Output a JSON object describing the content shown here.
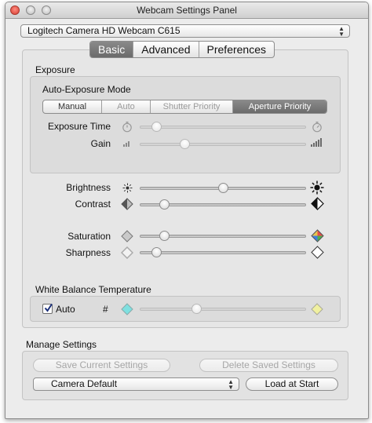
{
  "window": {
    "title": "Webcam Settings Panel"
  },
  "device": {
    "selected": "Logitech Camera HD Webcam C615"
  },
  "tabs": [
    {
      "label": "Basic",
      "selected": true
    },
    {
      "label": "Advanced",
      "selected": false
    },
    {
      "label": "Preferences",
      "selected": false
    }
  ],
  "exposure": {
    "group_label": "Exposure",
    "mode_label": "Auto-Exposure Mode",
    "modes": [
      {
        "label": "Manual",
        "state": "normal"
      },
      {
        "label": "Auto",
        "state": "disabled"
      },
      {
        "label": "Shutter Priority",
        "state": "disabled"
      },
      {
        "label": "Aperture Priority",
        "state": "selected"
      }
    ],
    "exposure_time": {
      "label": "Exposure Time",
      "value": 0.1,
      "enabled": false
    },
    "gain": {
      "label": "Gain",
      "value": 0.27,
      "enabled": false
    }
  },
  "image": {
    "brightness": {
      "label": "Brightness",
      "value": 0.5
    },
    "contrast": {
      "label": "Contrast",
      "value": 0.15
    },
    "saturation": {
      "label": "Saturation",
      "value": 0.15
    },
    "sharpness": {
      "label": "Sharpness",
      "value": 0.1
    }
  },
  "white_balance": {
    "group_label": "White Balance Temperature",
    "auto_label": "Auto",
    "auto_checked": true,
    "hash_label": "#",
    "value": 0.34,
    "enabled": false,
    "cool_color": "#7fe0e0",
    "warm_color": "#f0f0a0"
  },
  "manage": {
    "group_label": "Manage Settings",
    "save_label": "Save Current Settings",
    "delete_label": "Delete Saved Settings",
    "preset_selected": "Camera Default",
    "load_label": "Load at Start"
  },
  "icons": {
    "window_close": "close-icon",
    "window_minimize": "minimize-icon",
    "window_zoom": "zoom-icon",
    "exposure_min": "stopwatch-icon",
    "exposure_max": "stopwatch-icon",
    "gain_min": "signal-bars-small-icon",
    "gain_max": "signal-bars-large-icon",
    "brightness_min": "sun-small-icon",
    "brightness_max": "sun-large-icon",
    "contrast_min": "contrast-low-icon",
    "contrast_max": "contrast-high-icon",
    "saturation_min": "gray-diamond-icon",
    "saturation_max": "color-diamond-icon",
    "sharpness_min": "blurry-diamond-icon",
    "sharpness_max": "sharp-diamond-icon",
    "wb_min": "cyan-diamond-icon",
    "wb_max": "yellow-diamond-icon"
  }
}
